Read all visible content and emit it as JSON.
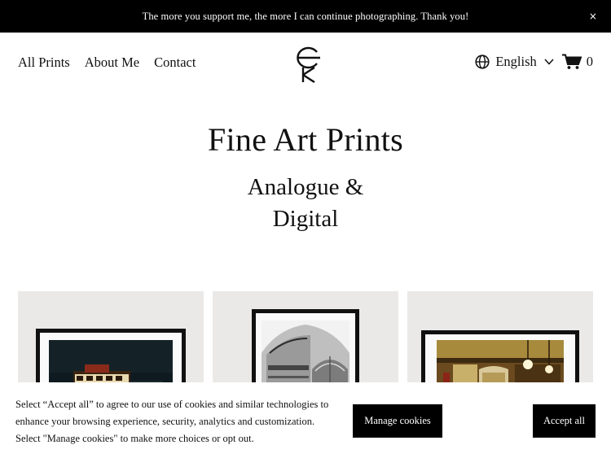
{
  "announcement": {
    "text": "The more you support me, the more I can continue photographing. Thank you!",
    "close_label": "×"
  },
  "nav": {
    "items": [
      {
        "label": "All Prints"
      },
      {
        "label": "About Me"
      },
      {
        "label": "Contact"
      }
    ]
  },
  "header": {
    "language": "English",
    "cart_count": "0",
    "icons": [
      "globe-icon",
      "chevron-down-icon",
      "cart-icon",
      "logo"
    ]
  },
  "hero": {
    "title": "Fine Art Prints",
    "subtitle_line1": "Analogue &",
    "subtitle_line2": "Digital"
  },
  "gallery": {
    "items": [
      {
        "subject": "night-cafe-print"
      },
      {
        "subject": "cathedral-bw-print"
      },
      {
        "subject": "vintage-interior-print"
      }
    ]
  },
  "cookie_banner": {
    "line1": "Select “Accept all” to agree to our use of cookies and similar technologies to",
    "line2": "enhance your browsing experience, security, analytics and customization.",
    "line3": "Select \"Manage cookies\" to make more choices or opt out.",
    "manage_label": "Manage cookies",
    "accept_label": "Accept all"
  },
  "colors": {
    "bar_bg": "#000000",
    "card_bg": "#ebe9e7",
    "text": "#111111"
  }
}
